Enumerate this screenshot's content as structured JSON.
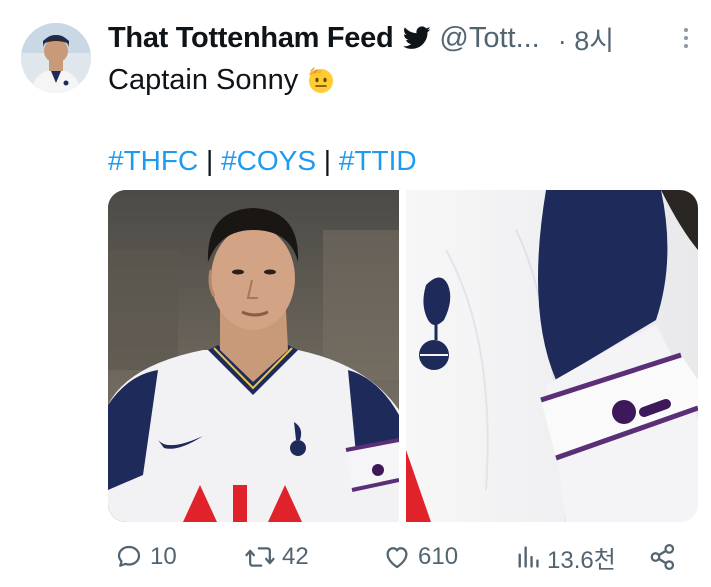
{
  "tweet": {
    "display_name": "That Tottenham Feed",
    "verified_icon": "twitter-bird-icon",
    "handle": "@Tott...",
    "time": "· 8시",
    "text": "Captain Sonny",
    "text_emoji": "saluting-face-emoji",
    "hashtags": [
      "#THFC",
      "#COYS",
      "#TTID"
    ],
    "separator": "|"
  },
  "stats": {
    "replies": "10",
    "retweets": "42",
    "likes": "610",
    "views": "13.6천"
  },
  "colors": {
    "link": "#1d9bf0",
    "text": "#0f1419",
    "secondary": "#536471",
    "spurs_navy": "#1e2a5a"
  }
}
